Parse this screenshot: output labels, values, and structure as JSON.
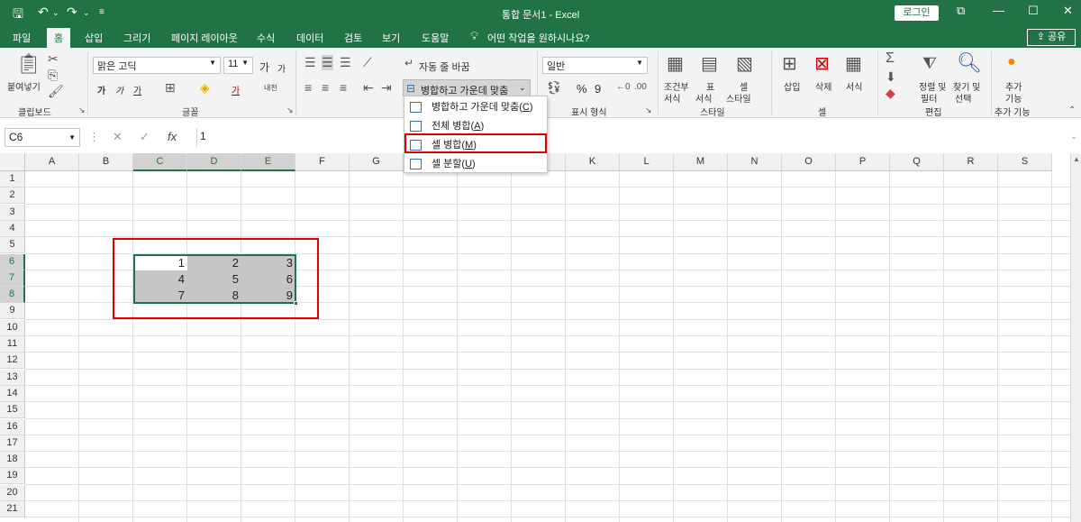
{
  "window": {
    "title": "통합 문서1  -  Excel",
    "login": "로그인"
  },
  "tabs": [
    {
      "label": "파일",
      "active": false
    },
    {
      "label": "홈",
      "active": true
    },
    {
      "label": "삽입",
      "active": false
    },
    {
      "label": "그리기",
      "active": false
    },
    {
      "label": "페이지 레이아웃",
      "active": false
    },
    {
      "label": "수식",
      "active": false
    },
    {
      "label": "데이터",
      "active": false
    },
    {
      "label": "검토",
      "active": false
    },
    {
      "label": "보기",
      "active": false
    },
    {
      "label": "도움말",
      "active": false
    }
  ],
  "tell_me": "어떤 작업을 원하시나요?",
  "share": "공유",
  "ribbon": {
    "clipboard": {
      "paste": "붙여넣기",
      "group": "클립보드"
    },
    "font": {
      "name": "맑은 고딕",
      "size": "11",
      "group": "글꼴",
      "grow": "가",
      "shrink": "가",
      "bold": "가",
      "italic": "가",
      "underline": "가",
      "color_a": "가",
      "phonetic": "내천"
    },
    "alignment": {
      "wrap": "자동 줄 바꿈",
      "merge": "병합하고 가운데 맞춤"
    },
    "number": {
      "format": "일반",
      "group": "표시 형식",
      "percent": "%",
      "comma": "9"
    },
    "styles": {
      "cond": "조건부",
      "cond2": "서식",
      "table": "표",
      "table2": "서식",
      "cell": "셀",
      "cell2": "스타일",
      "group": "스타일"
    },
    "cells": {
      "insert": "삽입",
      "delete": "삭제",
      "format": "서식",
      "group": "셀"
    },
    "editing": {
      "sort": "정렬 및",
      "sort2": "필터",
      "find": "찾기 및",
      "find2": "선택",
      "group": "편집"
    },
    "addins": {
      "label": "추가",
      "label2": "기능",
      "group": "추가 기능"
    }
  },
  "formula_bar": {
    "name_box": "C6",
    "fx": "fx",
    "value": "1"
  },
  "columns": [
    "A",
    "B",
    "C",
    "D",
    "E",
    "F",
    "G",
    "H",
    "I",
    "J",
    "K",
    "L",
    "M",
    "N",
    "O",
    "P",
    "Q",
    "R",
    "S"
  ],
  "rows": [
    "1",
    "2",
    "3",
    "4",
    "5",
    "6",
    "7",
    "8",
    "9",
    "10",
    "11",
    "12",
    "13",
    "14",
    "15",
    "16",
    "17",
    "18",
    "19",
    "20",
    "21"
  ],
  "cells": [
    [
      "1",
      "2",
      "3"
    ],
    [
      "4",
      "5",
      "6"
    ],
    [
      "7",
      "8",
      "9"
    ]
  ],
  "merge_menu": [
    {
      "label": "병합하고 가운데 맞춤",
      "key": "C"
    },
    {
      "label": "전체 병합",
      "key": "A"
    },
    {
      "label": "셀 병합",
      "key": "M"
    },
    {
      "label": "셀 분할",
      "key": "U"
    }
  ],
  "colors": {
    "accent": "#217346",
    "highlight": "#e00000",
    "selection": "#c6c6c6"
  }
}
